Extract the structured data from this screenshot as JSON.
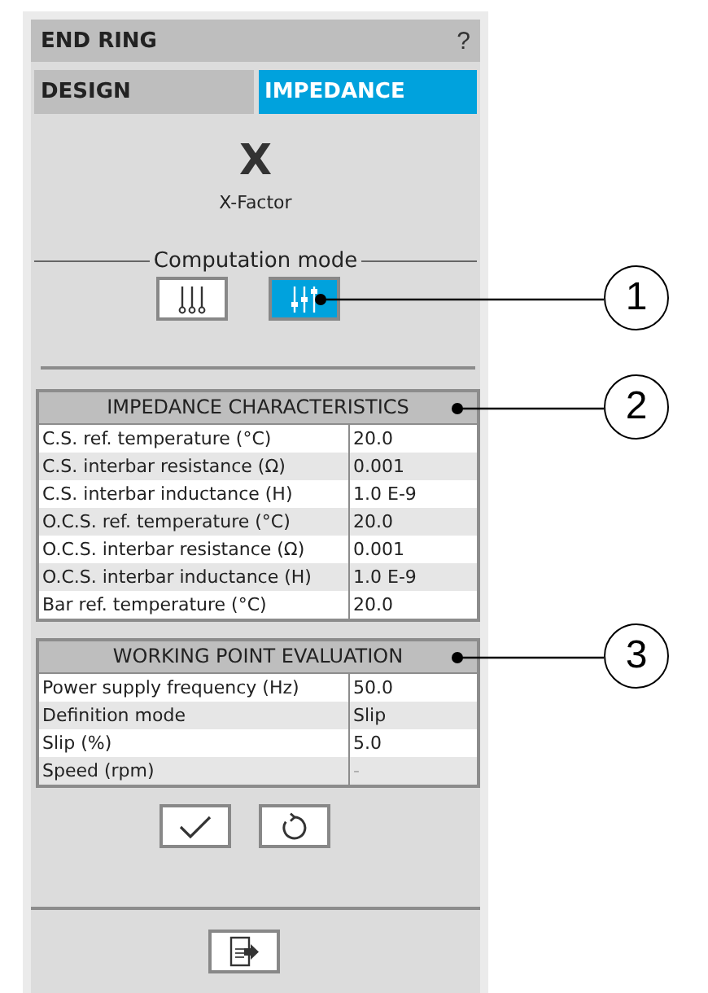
{
  "panel": {
    "title": "END RING",
    "help": "?"
  },
  "tabs": [
    {
      "label": "DESIGN",
      "selected": false
    },
    {
      "label": "IMPEDANCE",
      "selected": true
    }
  ],
  "factor": {
    "symbol": "X",
    "label": "X-Factor"
  },
  "computation_mode": {
    "label": "Computation mode",
    "options": [
      {
        "kind": "fixed",
        "selected": false
      },
      {
        "kind": "adjustable",
        "selected": true
      }
    ]
  },
  "tables": [
    {
      "title": "IMPEDANCE CHARACTERISTICS",
      "rows": [
        {
          "label": "C.S. ref. temperature (°C)",
          "value": "20.0",
          "disabled": false
        },
        {
          "label": "C.S. interbar resistance (Ω)",
          "value": "0.001",
          "disabled": false
        },
        {
          "label": "C.S. interbar inductance (H)",
          "value": "1.0 E-9",
          "disabled": false
        },
        {
          "label": "O.C.S. ref. temperature (°C)",
          "value": "20.0",
          "disabled": false
        },
        {
          "label": "O.C.S. interbar resistance (Ω)",
          "value": "0.001",
          "disabled": false
        },
        {
          "label": "O.C.S. interbar inductance (H)",
          "value": "1.0 E-9",
          "disabled": false
        },
        {
          "label": "Bar ref. temperature (°C)",
          "value": "20.0",
          "disabled": false
        }
      ]
    },
    {
      "title": "WORKING POINT EVALUATION",
      "rows": [
        {
          "label": "Power supply frequency (Hz)",
          "value": "50.0",
          "disabled": false
        },
        {
          "label": "Definition mode",
          "value": "Slip",
          "disabled": false
        },
        {
          "label": "Slip (%)",
          "value": "5.0",
          "disabled": false
        },
        {
          "label": "Speed (rpm)",
          "value": "-",
          "disabled": true
        }
      ]
    }
  ],
  "actions": [
    {
      "kind": "apply"
    },
    {
      "kind": "reset"
    }
  ],
  "footer_actions": [
    {
      "kind": "export"
    }
  ],
  "callouts": [
    {
      "label": "1"
    },
    {
      "label": "2"
    },
    {
      "label": "3"
    }
  ]
}
